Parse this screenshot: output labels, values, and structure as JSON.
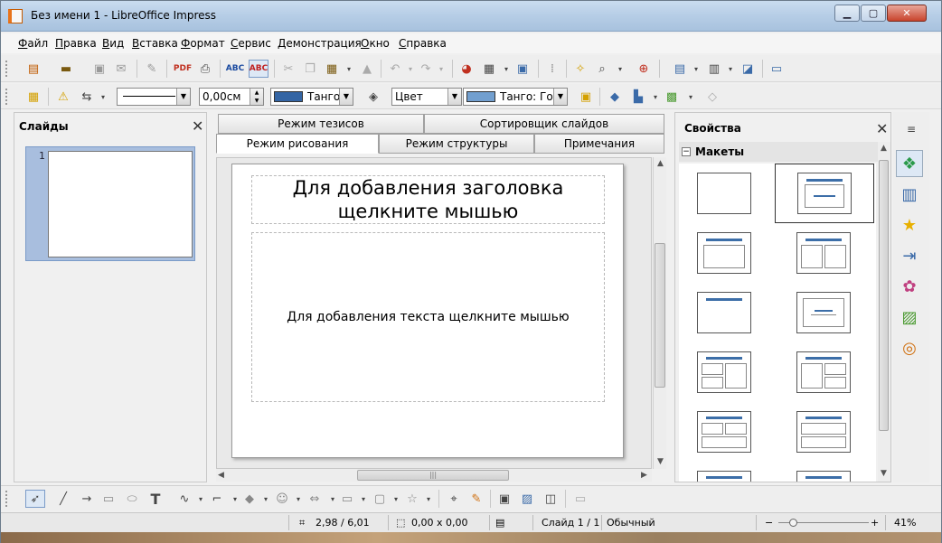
{
  "window": {
    "title": "Без имени 1 - LibreOffice Impress",
    "min": "▁",
    "max": "▢",
    "close": "✕"
  },
  "menu": [
    "Файл",
    "Правка",
    "Вид",
    "Вставка",
    "Формат",
    "Сервис",
    "Демонстрация",
    "Окно",
    "Справка"
  ],
  "toolbar2": {
    "line_width": "0,00см",
    "area_style": "Цвет",
    "line_color": "Танго:",
    "area_color": "Танго: Гол"
  },
  "slides_pane": {
    "title": "Слайды",
    "slide_number": "1",
    "close": "✕"
  },
  "view_tabs": {
    "row1": [
      "Режим тезисов",
      "Сортировщик слайдов"
    ],
    "row2": [
      "Режим рисования",
      "Режим структуры",
      "Примечания"
    ]
  },
  "slide": {
    "title_placeholder": "Для добавления заголовка щелкните мышью",
    "body_placeholder": "Для добавления текста щелкните мышью"
  },
  "properties": {
    "title": "Свойства",
    "section": "Макеты",
    "toggle": "−",
    "close": "✕"
  },
  "status": {
    "position": "2,98 / 6,01",
    "size": "0,00 x 0,00",
    "slide": "Слайд 1 / 1",
    "layout": "Обычный",
    "zoom": "41%"
  }
}
